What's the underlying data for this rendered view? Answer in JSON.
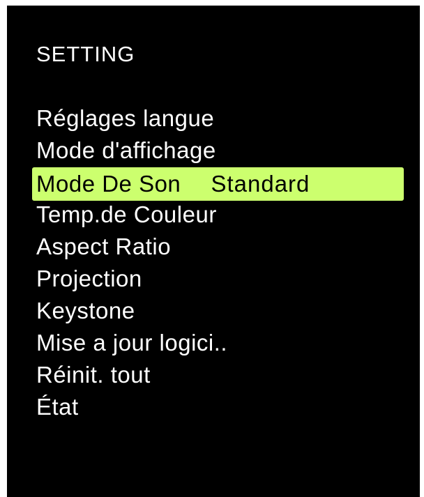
{
  "menu": {
    "title": "SETTING",
    "items": [
      {
        "label": "Réglages langue",
        "value": ""
      },
      {
        "label": "Mode d'affichage",
        "value": ""
      },
      {
        "label": "Mode De Son",
        "value": "Standard"
      },
      {
        "label": "Temp.de Couleur",
        "value": ""
      },
      {
        "label": "Aspect Ratio",
        "value": ""
      },
      {
        "label": "Projection",
        "value": ""
      },
      {
        "label": "Keystone",
        "value": ""
      },
      {
        "label": "Mise a jour logici..",
        "value": ""
      },
      {
        "label": "Réinit. tout",
        "value": ""
      },
      {
        "label": "État",
        "value": ""
      }
    ],
    "selected_index": 2
  },
  "colors": {
    "background": "#000000",
    "text": "#ffffff",
    "highlight": "#ccff6e",
    "highlight_text": "#000000"
  }
}
